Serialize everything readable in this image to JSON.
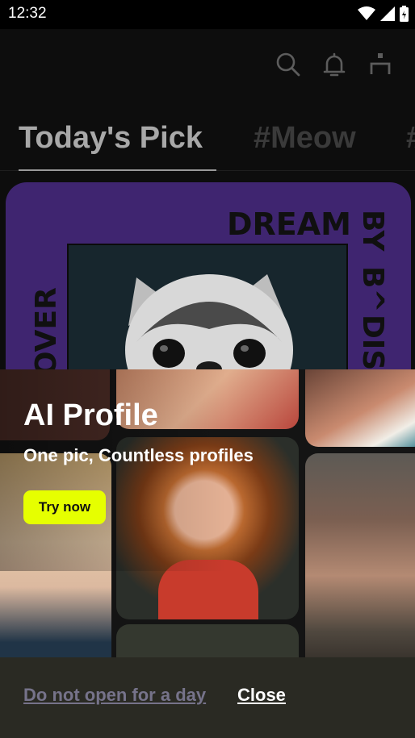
{
  "status": {
    "time": "12:32"
  },
  "topbar": {
    "icons": [
      "search-icon",
      "bell-icon",
      "profile-icon"
    ]
  },
  "tabs": [
    {
      "label": "Today's Pick"
    },
    {
      "label": "#Meow"
    },
    {
      "label": "#"
    }
  ],
  "card": {
    "words": [
      "DREAM",
      "BY",
      "B^",
      "DIS",
      "OVER"
    ]
  },
  "promo": {
    "title": "AI Profile",
    "subtitle": "One pic, Countless profiles",
    "button_label": "Try now"
  },
  "footer": {
    "dismiss_label": "Do not open for a day",
    "close_label": "Close"
  },
  "colors": {
    "accent": "#e6ff00",
    "card_purple": "#3f2570",
    "dismiss_text": "#76738a"
  }
}
